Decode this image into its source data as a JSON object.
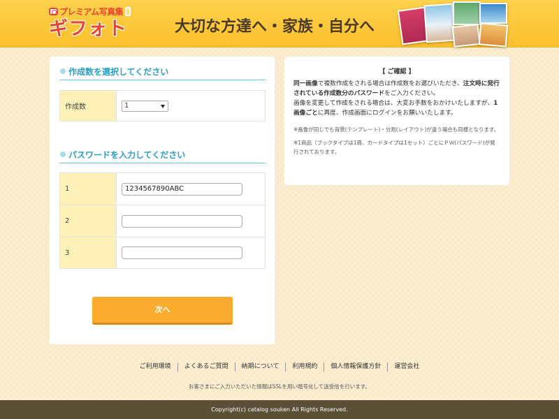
{
  "brand": {
    "sub_title": "プレミアム写真集",
    "logo_text": "ギフォト",
    "tagline": "大切な方達へ・家族・自分へ"
  },
  "colors": {
    "header_yellow": "#fbc02d",
    "accent_orange": "#fbab2e",
    "section_blue": "#2a9ec3",
    "label_yellow": "#fff2b8",
    "footer_brown": "#5b4f36"
  },
  "quantity_section": {
    "title": "作成数を選択してください",
    "label": "作成数",
    "selected_value": "1"
  },
  "password_section": {
    "title": "パスワードを入力してください",
    "rows": [
      {
        "label": "1",
        "value": "1234567890ABC"
      },
      {
        "label": "2",
        "value": ""
      },
      {
        "label": "3",
        "value": ""
      }
    ]
  },
  "next_button": {
    "label": "次へ"
  },
  "confirm": {
    "title": "【 ご確認 】",
    "p1_a": "同一画像",
    "p1_b": "で複数作成をされる場合は作成数をお選びいただき、",
    "p1_c": "注文時に発行されている作成数分のパスワード",
    "p1_d": "をご入力ください。",
    "p2_a": "画像を変更して作成をされる場合は、大変お手数をおかけいたしますが、",
    "p2_b": "1画像ごと",
    "p2_c": "に再度、作成画面にログインをお願いいたします。",
    "note1": "※画像が同じでも背景(テンプレート)・分割(レイアウト)が違う場合も同様となります。",
    "note2": "※1商品（ブックタイプは1冊、カードタイプは1セット）ごとにＰＷ(パスワード)が発行されております。"
  },
  "footer": {
    "links": [
      "ご利用環境",
      "よくあるご質問",
      "納期について",
      "利用規約",
      "個人情報保護方針",
      "運営会社"
    ],
    "ssl_note": "お客さまにご入力いただいた情報はSSLを用い暗号化して送受信を行います。",
    "copyright": "Copyright(c) catalog souken All Rights Reserved."
  }
}
